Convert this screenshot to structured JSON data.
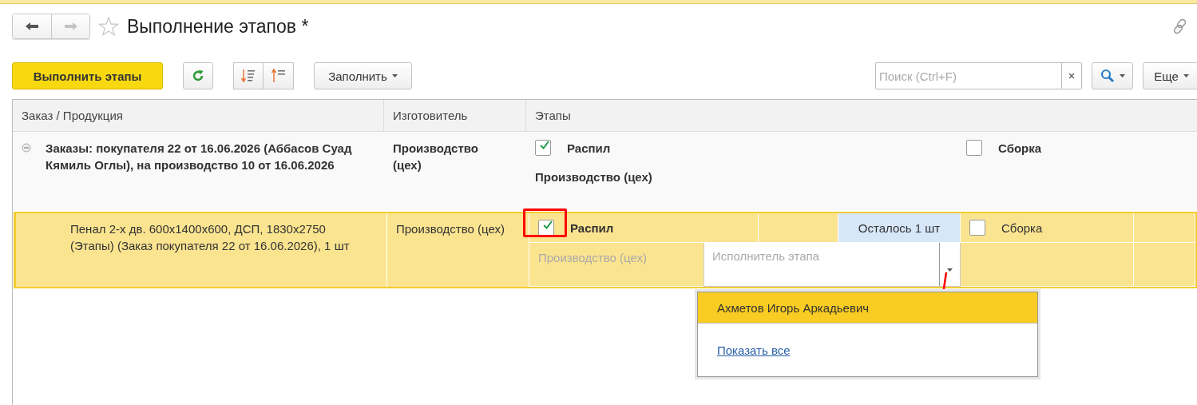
{
  "nav_buttons": [
    {
      "kind": "back",
      "disabled": false
    },
    {
      "kind": "forward",
      "disabled": true
    }
  ],
  "title": "Выполнение этапов *",
  "toolbar": {
    "primary_button": "Выполнить этапы",
    "fill_button": "Заполнить",
    "search": {
      "placeholder": "Поиск (Ctrl+F)"
    },
    "more_button": "Еще"
  },
  "table": {
    "columns": [
      "Заказ / Продукция",
      "Изготовитель",
      "Этапы"
    ],
    "rows": [
      {
        "expanded": true,
        "selected": false,
        "title": "Заказы: покупателя 22 от 16.06.2026  (Аббасов Суад Кямиль Оглы), на производство 10 от 16.06.2026",
        "maker": "Производство (цех)",
        "stages": [
          {
            "name": "Распил",
            "checked": true
          },
          {
            "name": "Сборка",
            "checked": false
          }
        ],
        "stage_maker": "Производство (цех)"
      },
      {
        "selected": true,
        "title": "Пенал 2-х дв. 600х1400х600, ДСП, 1830х2750 (Этапы) (Заказ покупателя 22 от 16.06.2026), 1 шт",
        "maker": "Производство (цех)",
        "stages": [
          {
            "name": "Распил",
            "checked": true
          },
          {
            "name": "Сборка",
            "checked": false
          }
        ],
        "remaining": "Осталось 1 шт",
        "stage_maker": "Производство (цех)",
        "executor": {
          "placeholder": "Исполнитель этапа"
        }
      }
    ]
  },
  "dropdown": {
    "items": [
      {
        "label": "Ахметов Игорь Аркадьевич",
        "selected": true
      }
    ],
    "show_all": "Показать все"
  }
}
